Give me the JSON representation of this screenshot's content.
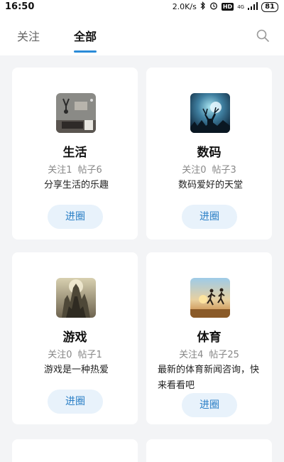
{
  "status_bar": {
    "time": "16:50",
    "speed": "2.0K/s",
    "battery": "81",
    "net_type": "4G"
  },
  "tabs": [
    {
      "label": "关注",
      "active": false
    },
    {
      "label": "全部",
      "active": true
    }
  ],
  "icons": {
    "search": "search-icon",
    "bluetooth": "bluetooth-icon",
    "alarm": "alarm-icon",
    "hd": "HD",
    "signal": "signal-icon"
  },
  "colors": {
    "accent": "#2a8bd8",
    "button_bg": "#e8f2fb",
    "button_text": "#2a7fc6",
    "page_bg": "#f3f4f6"
  },
  "cards": [
    {
      "name": "生活",
      "follow": "关注1",
      "posts": "帖子6",
      "desc": "分享生活的乐趣",
      "button": "进圈",
      "image": "life-thumbnail"
    },
    {
      "name": "数码",
      "follow": "关注0",
      "posts": "帖子3",
      "desc": "数码爱好的天堂",
      "button": "进圈",
      "image": "digital-thumbnail"
    },
    {
      "name": "游戏",
      "follow": "关注0",
      "posts": "帖子1",
      "desc": "游戏是一种热爱",
      "button": "进圈",
      "image": "game-thumbnail"
    },
    {
      "name": "体育",
      "follow": "关注4",
      "posts": "帖子25",
      "desc": "最新的体育新闻咨询，快来看看吧",
      "button": "进圈",
      "image": "sports-thumbnail"
    }
  ]
}
